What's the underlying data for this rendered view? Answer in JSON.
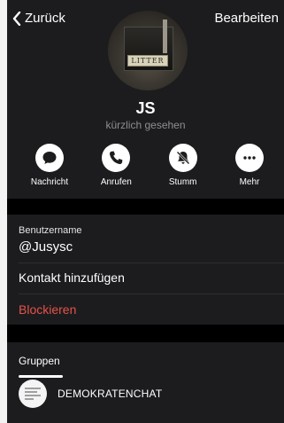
{
  "nav": {
    "back_label": "Zurück",
    "edit_label": "Bearbeiten"
  },
  "profile": {
    "avatar_text": "LITTER",
    "name": "JS",
    "status": "kürzlich gesehen"
  },
  "actions": [
    {
      "label": "Nachricht",
      "icon": "chat-bubble-icon"
    },
    {
      "label": "Anrufen",
      "icon": "phone-icon"
    },
    {
      "label": "Stumm",
      "icon": "bell-slash-icon"
    },
    {
      "label": "Mehr",
      "icon": "more-dots-icon"
    }
  ],
  "info": {
    "username_label": "Benutzername",
    "username_value": "@Jusysc",
    "add_contact": "Kontakt hinzufügen",
    "block": "Blockieren"
  },
  "tabs": {
    "groups_label": "Gruppen"
  },
  "groups": [
    {
      "name": "DEMOKRATENCHAT"
    }
  ],
  "colors": {
    "background": "#1c1c1e",
    "danger": "#e5534b",
    "muted": "#8e8e93"
  }
}
